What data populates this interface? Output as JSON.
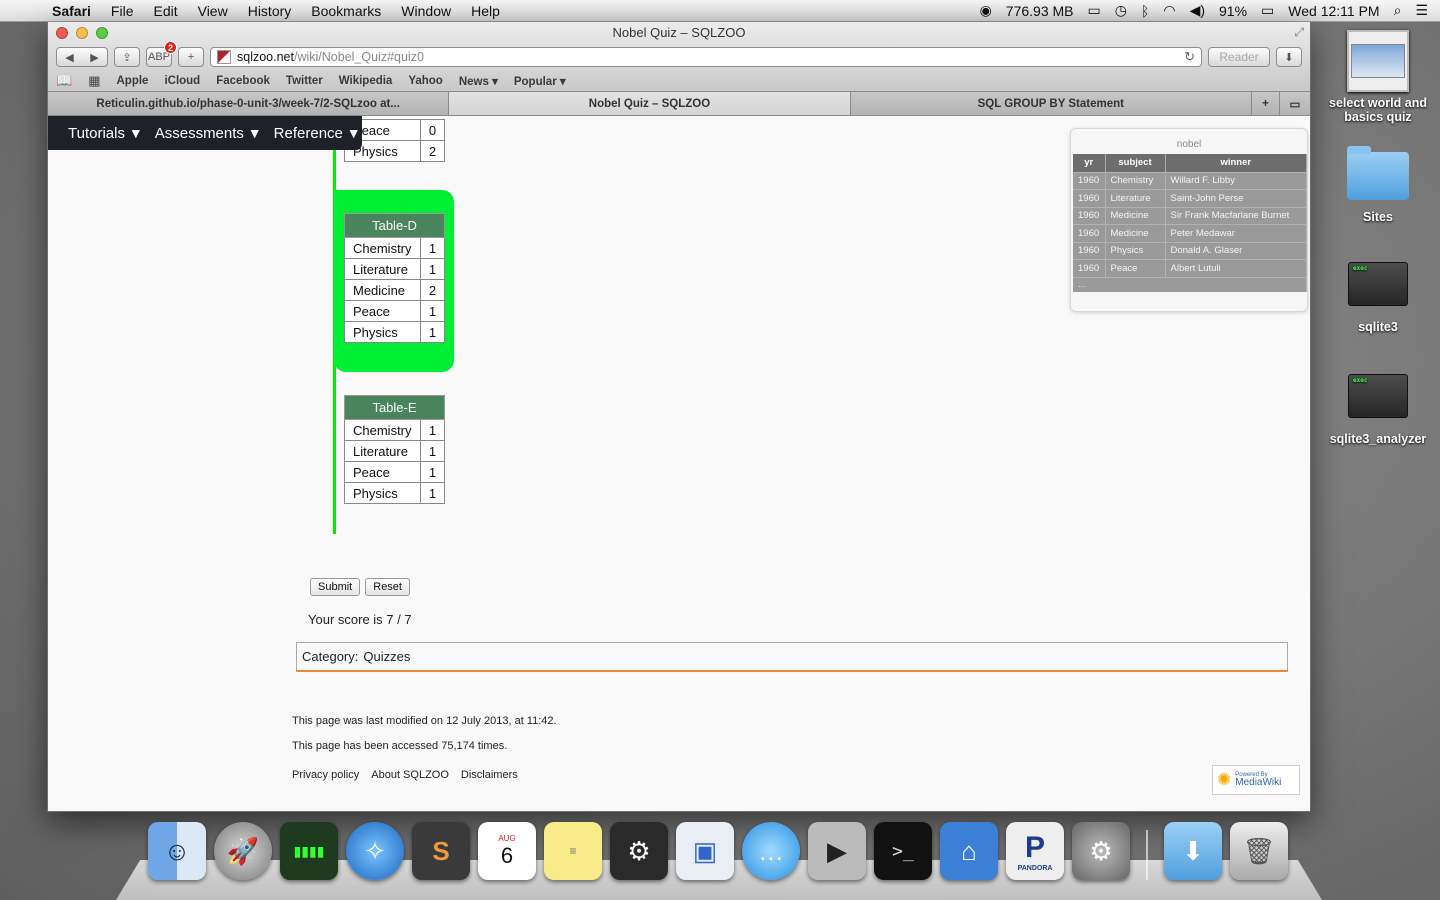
{
  "menubar": {
    "app_name": "Safari",
    "menus": [
      "File",
      "Edit",
      "View",
      "History",
      "Bookmarks",
      "Window",
      "Help"
    ],
    "memory": "776.93 MB",
    "battery": "91%",
    "clock": "Wed 12:11 PM"
  },
  "window": {
    "title": "Nobel Quiz – SQLZOO",
    "adblock_badge": "2",
    "url_domain": "sqlzoo.net",
    "url_path": "/wiki/Nobel_Quiz#quiz0",
    "reader_label": "Reader",
    "bookmarks": [
      "Apple",
      "iCloud",
      "Facebook",
      "Twitter",
      "Wikipedia",
      "Yahoo",
      "News ▾",
      "Popular ▾"
    ],
    "tabs": [
      {
        "label": "Reticulin.github.io/phase-0-unit-3/week-7/2-SQLzoo at..."
      },
      {
        "label": "Nobel Quiz – SQLZOO"
      },
      {
        "label": "SQL GROUP BY Statement"
      }
    ]
  },
  "sitenav": {
    "items": [
      "Tutorials",
      "Assessments",
      "Reference"
    ]
  },
  "quiz": {
    "top_table_rows": [
      {
        "subject": "Peace",
        "count": "0"
      },
      {
        "subject": "Physics",
        "count": "2"
      }
    ],
    "table_d": {
      "title": "Table-D",
      "rows": [
        {
          "subject": "Chemistry",
          "count": "1"
        },
        {
          "subject": "Literature",
          "count": "1"
        },
        {
          "subject": "Medicine",
          "count": "2"
        },
        {
          "subject": "Peace",
          "count": "1"
        },
        {
          "subject": "Physics",
          "count": "1"
        }
      ]
    },
    "table_e": {
      "title": "Table-E",
      "rows": [
        {
          "subject": "Chemistry",
          "count": "1"
        },
        {
          "subject": "Literature",
          "count": "1"
        },
        {
          "subject": "Peace",
          "count": "1"
        },
        {
          "subject": "Physics",
          "count": "1"
        }
      ]
    },
    "submit_label": "Submit",
    "reset_label": "Reset",
    "score_text": "Your score is 7 / 7",
    "category_label": "Category:",
    "category_value": "Quizzes"
  },
  "footer": {
    "modified": "This page was last modified on 12 July 2013, at 11:42.",
    "accessed": "This page has been accessed 75,174 times.",
    "links": [
      "Privacy policy",
      "About SQLZOO",
      "Disclaimers"
    ],
    "powered_small": "Powered By",
    "powered_big": "MediaWiki"
  },
  "nobel_widget": {
    "title": "nobel",
    "headers": [
      "yr",
      "subject",
      "winner"
    ],
    "rows": [
      [
        "1960",
        "Chemistry",
        "Willard F. Libby"
      ],
      [
        "1960",
        "Literature",
        "Saint-John Perse"
      ],
      [
        "1960",
        "Medicine",
        "Sir Frank Macfarlane Burnet"
      ],
      [
        "1960",
        "Medicine",
        "Peter Medawar"
      ],
      [
        "1960",
        "Physics",
        "Donald A. Glaser"
      ],
      [
        "1960",
        "Peace",
        "Albert Lutuli"
      ]
    ],
    "more": "..."
  },
  "desktop": {
    "icons": [
      {
        "label": "select world and basics quiz",
        "icon": "document-thumbnail"
      },
      {
        "label": "Sites",
        "icon": "folder-icon"
      },
      {
        "label": "sqlite3",
        "icon": "exec-icon"
      },
      {
        "label": "sqlite3_analyzer",
        "icon": "exec-icon"
      }
    ]
  },
  "dock": {
    "apps": [
      "Finder",
      "Launchpad",
      "Activity Monitor",
      "Safari",
      "Sublime Text",
      "Calendar",
      "Stickies",
      "Steam",
      "Preview",
      "Messages",
      "FaceTime",
      "Terminal",
      "Keynote",
      "Pandora",
      "System Preferences",
      "Downloads",
      "Trash"
    ],
    "calendar_month": "AUG",
    "calendar_day": "6",
    "pandora_label": "PANDORA"
  },
  "colors": {
    "quiz_correct": "#00ee33",
    "table_header": "#4a845c",
    "sitenav_bg": "#1f2129",
    "category_border": "#ef8a3c"
  }
}
